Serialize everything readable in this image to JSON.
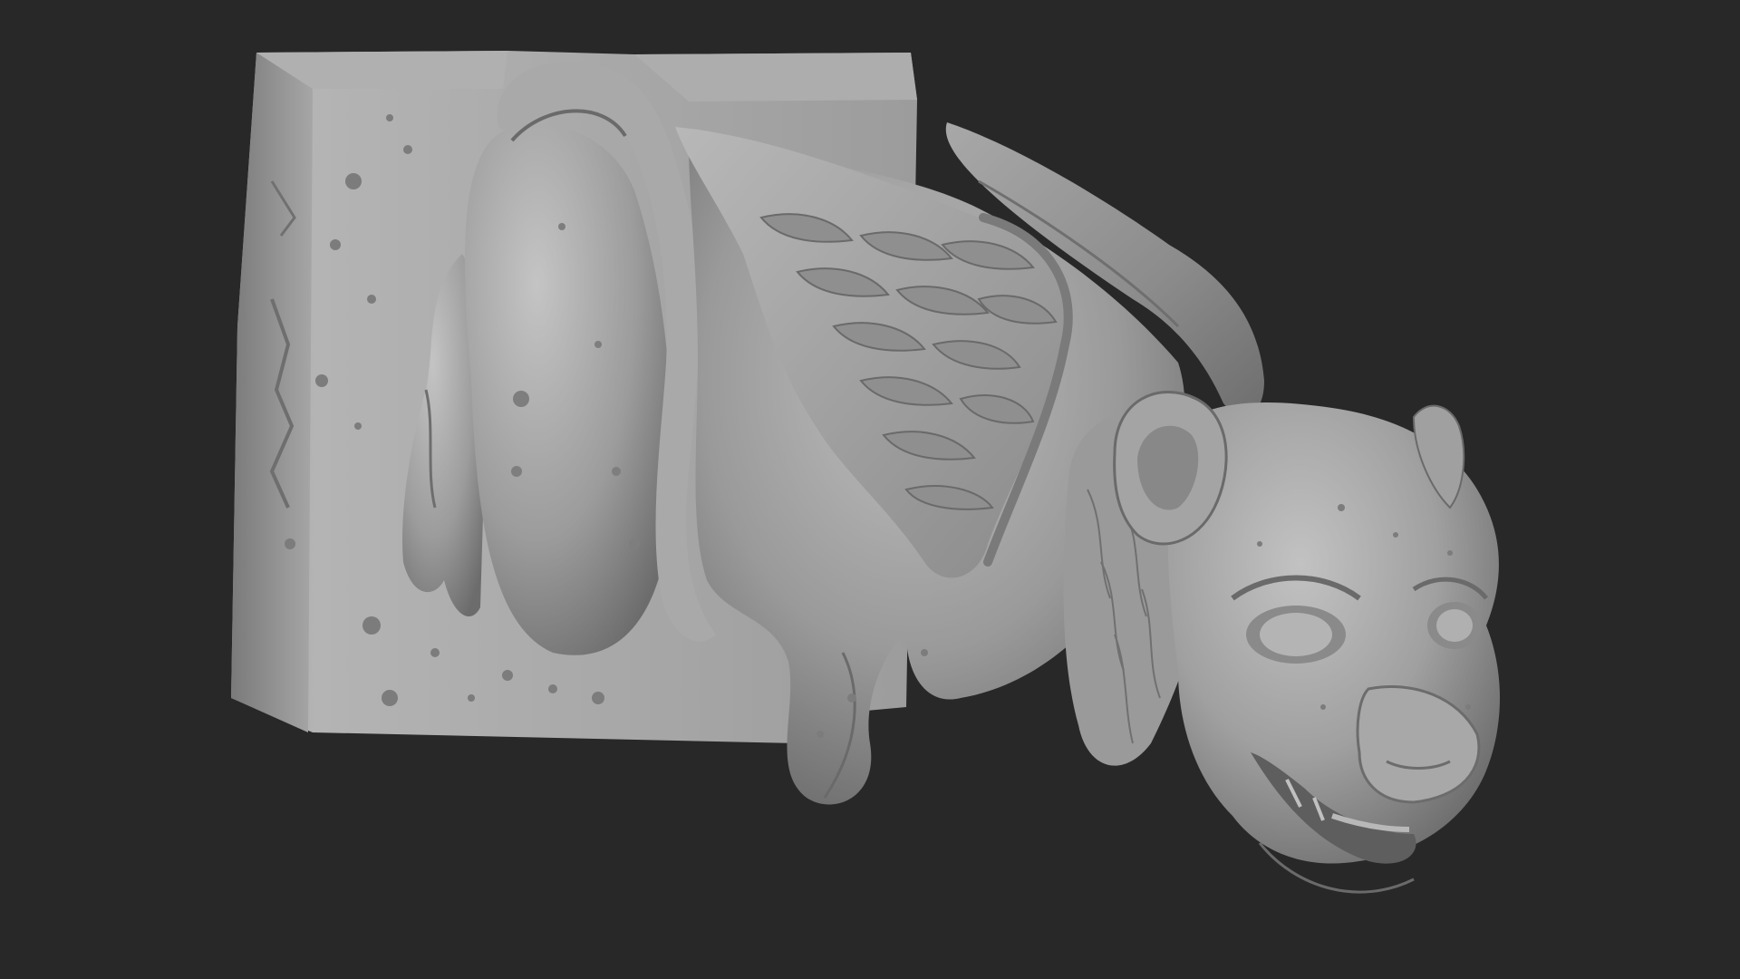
{
  "viewport": {
    "background_color": "#282828",
    "model_color": "#9a9a9a",
    "model_highlight": "#c8c8c8",
    "model_shadow": "#5a5a5a"
  },
  "model": {
    "subject": "winged-lion-gargoyle",
    "parts": [
      "stone-block",
      "tail",
      "body",
      "wing",
      "horn",
      "ear",
      "mane",
      "face",
      "eye",
      "nose",
      "mouth",
      "leg"
    ]
  }
}
